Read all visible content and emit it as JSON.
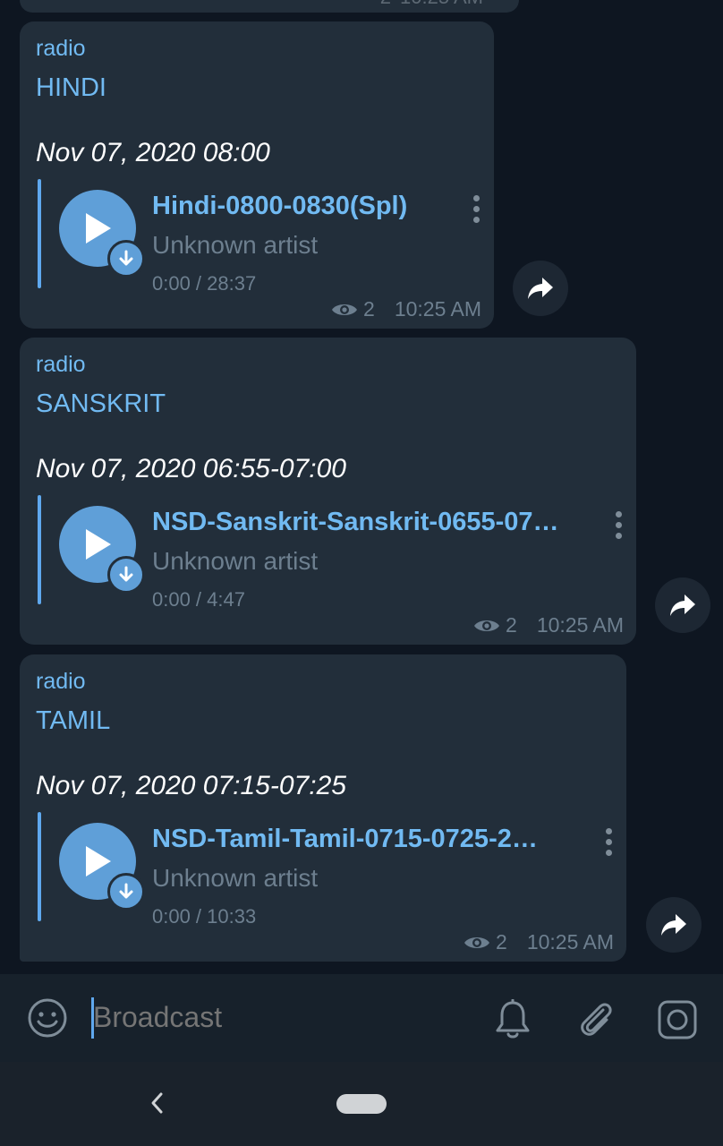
{
  "previous_message": {
    "views": "2",
    "time": "10:25 AM"
  },
  "messages": [
    {
      "sender": "radio",
      "language": "HINDI",
      "date": "Nov 07, 2020 08:00",
      "track_title": "Hindi-0800-0830(Spl)",
      "artist": "Unknown artist",
      "duration": "0:00 / 28:37",
      "views": "2",
      "time": "10:25 AM"
    },
    {
      "sender": "radio",
      "language": "SANSKRIT",
      "date": "Nov 07, 2020 06:55-07:00",
      "track_title": "NSD-Sanskrit-Sanskrit-0655-07…",
      "artist": "Unknown artist",
      "duration": "0:00 / 4:47",
      "views": "2",
      "time": "10:25 AM"
    },
    {
      "sender": "radio",
      "language": "TAMIL",
      "date": "Nov 07, 2020 07:15-07:25",
      "track_title": "NSD-Tamil-Tamil-0715-0725-2…",
      "artist": "Unknown artist",
      "duration": "0:00 / 10:33",
      "views": "2",
      "time": "10:25 AM"
    }
  ],
  "composer": {
    "placeholder": "Broadcast",
    "icons": [
      "emoji-icon",
      "bell-icon",
      "paperclip-icon",
      "camera-icon"
    ]
  },
  "colors": {
    "accent": "#71baf2",
    "bubble": "#222e3a",
    "background": "#0e1621",
    "secondary_text": "#6d7f8f"
  }
}
